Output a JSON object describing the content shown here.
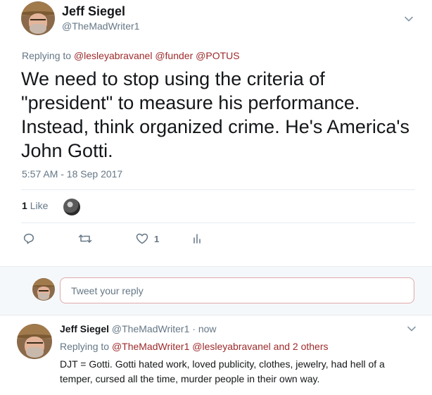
{
  "main_tweet": {
    "author_name": "Jeff Siegel",
    "author_handle": "@TheMadWriter1",
    "replying_prefix": "Replying to",
    "mentions": [
      "@lesleyabravanel",
      "@funder",
      "@POTUS"
    ],
    "text": "We need to stop using the criteria of \"president\" to measure his performance. Instead, think organized crime. He's America's John Gotti.",
    "timestamp": "5:57 AM - 18 Sep 2017",
    "likes": {
      "count": "1",
      "label": "Like"
    },
    "actions": {
      "reply_icon": "reply-icon",
      "retweet_icon": "retweet-icon",
      "like_icon": "heart-icon",
      "like_count": "1",
      "analytics_icon": "analytics-icon"
    }
  },
  "reply_box": {
    "placeholder": "Tweet your reply"
  },
  "reply_tweet": {
    "author_name": "Jeff Siegel",
    "author_handle": "@TheMadWriter1",
    "separator": "·",
    "time": "now",
    "replying_prefix": "Replying to",
    "mentions": [
      "@TheMadWriter1",
      "@lesleyabravanel"
    ],
    "and_others": "and 2 others",
    "text": "DJT = Gotti. Gotti hated work, loved publicity, clothes, jewelry, had hell of a temper, cursed all the time, murder people in their own way."
  },
  "colors": {
    "text_primary": "#14171a",
    "text_secondary": "#657786",
    "mention": "#9e2a2b",
    "divider": "#e6ecf0",
    "composer_bg": "#f5f8fa",
    "input_border": "#e0a9ab"
  }
}
